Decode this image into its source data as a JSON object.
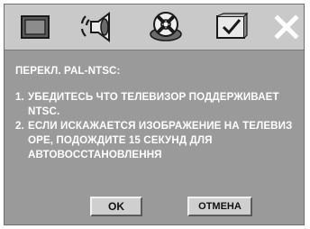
{
  "toolbar": {
    "icons": [
      "screen-icon",
      "speaker-icon",
      "disc-icon",
      "settings-checkmark-icon",
      "close-icon"
    ]
  },
  "dialog": {
    "title": "ПЕРЕКЛ. PAL-NTSC:",
    "items": [
      {
        "num": "1.",
        "text": "УБЕДИТЕСЬ ЧТО ТЕЛЕВИЗОР ПОДДЕРЖИВАЕТ NTSC."
      },
      {
        "num": "2.",
        "text": "ЕСЛИ ИСКАЖАЕТСЯ ИЗОБРАЖЕНИЕ НА ТЕЛЕВИЗ ОРЕ, ПОДОЖДИТЕ 15 СЕКУНД ДЛЯ АВТОВОССТАНОВЛЕННЯ"
      }
    ],
    "ok_label": "OK",
    "cancel_label": "ОТМЕНА"
  }
}
